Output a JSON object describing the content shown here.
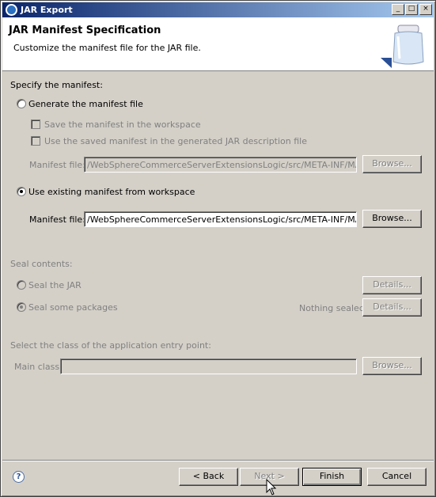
{
  "window": {
    "title": "JAR Export",
    "controls": {
      "minimize": "_",
      "maximize": "□",
      "close": "×"
    }
  },
  "banner": {
    "title": "JAR Manifest Specification",
    "description": "Customize the manifest file for the JAR file.",
    "icon": "jar-icon"
  },
  "manifest": {
    "section_label": "Specify the manifest:",
    "generate_label": "Generate the manifest file",
    "save_in_workspace_label": "Save the manifest in the workspace",
    "use_saved_label": "Use the saved manifest in the generated JAR description file",
    "generated_file_label": "Manifest file:",
    "generated_file_value": "/WebSphereCommerceServerExtensionsLogic/src/META-INF/MANIFEST",
    "generated_browse_label": "Browse...",
    "use_existing_label": "Use existing manifest from workspace",
    "existing_file_label": "Manifest file:",
    "existing_file_value": "/WebSphereCommerceServerExtensionsLogic/src/META-INF/MANIFEST",
    "existing_browse_label": "Browse...",
    "selected_option": "use_existing"
  },
  "seal": {
    "section_label": "Seal contents:",
    "seal_jar_label": "Seal the JAR",
    "seal_jar_details_label": "Details...",
    "seal_some_label": "Seal some packages",
    "nothing_sealed_label": "Nothing sealed",
    "seal_some_details_label": "Details..."
  },
  "entry_point": {
    "section_label": "Select the class of the application entry point:",
    "main_class_label": "Main class:",
    "main_class_value": "",
    "browse_label": "Browse..."
  },
  "footer": {
    "help_glyph": "?",
    "back_label": "< Back",
    "next_label": "Next >",
    "finish_label": "Finish",
    "cancel_label": "Cancel"
  },
  "colors": {
    "dialog_bg": "#d4d0c8",
    "titlebar_start": "#0a246a",
    "titlebar_end": "#a6caf0",
    "disabled_text": "#808080"
  }
}
